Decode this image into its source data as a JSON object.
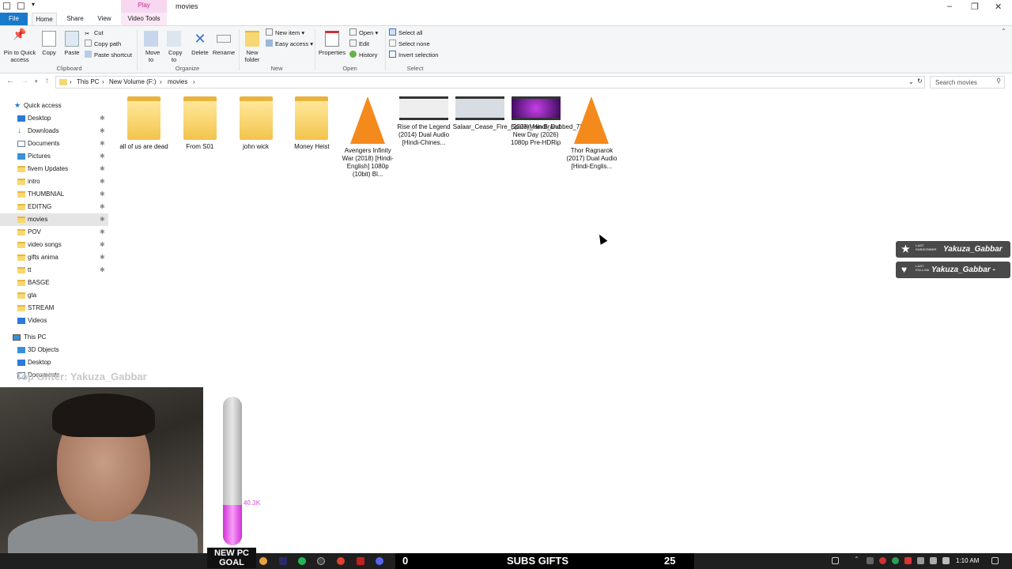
{
  "window": {
    "title": "movies",
    "context_tab": "Play",
    "tabs": [
      "File",
      "Home",
      "Share",
      "View",
      "Video Tools"
    ]
  },
  "ribbon": {
    "clipboard": {
      "pin": "Pin to Quick access",
      "copy": "Copy",
      "paste": "Paste",
      "cut": "Cut",
      "copy_path": "Copy path",
      "paste_shortcut": "Paste shortcut",
      "label": "Clipboard"
    },
    "organize": {
      "move_to": "Move to",
      "copy_to": "Copy to",
      "delete": "Delete",
      "rename": "Rename",
      "label": "Organize"
    },
    "new": {
      "new_folder": "New folder",
      "new_item": "New item",
      "easy_access": "Easy access",
      "label": "New"
    },
    "open": {
      "properties": "Properties",
      "open": "Open",
      "edit": "Edit",
      "history": "History",
      "label": "Open"
    },
    "select": {
      "select_all": "Select all",
      "select_none": "Select none",
      "invert": "Invert selection",
      "label": "Select"
    }
  },
  "address": {
    "crumbs": [
      "This PC",
      "New Volume (F:)",
      "movies"
    ],
    "search_placeholder": "Search movies"
  },
  "nav": {
    "quick_access": "Quick access",
    "items": [
      {
        "label": "Desktop",
        "icon": "desktop-icon",
        "pinned": true
      },
      {
        "label": "Downloads",
        "icon": "download-icon",
        "pinned": true
      },
      {
        "label": "Documents",
        "icon": "document-icon",
        "pinned": true
      },
      {
        "label": "Pictures",
        "icon": "picture-icon",
        "pinned": true
      },
      {
        "label": "fivem Updates",
        "icon": "folder-icon",
        "pinned": true
      },
      {
        "label": "intro",
        "icon": "folder-icon",
        "pinned": true
      },
      {
        "label": "THUMBNIAL",
        "icon": "folder-icon",
        "pinned": true
      },
      {
        "label": "EDITNG",
        "icon": "folder-icon",
        "pinned": true
      },
      {
        "label": "movies",
        "icon": "folder-icon",
        "pinned": true,
        "selected": true
      },
      {
        "label": "POV",
        "icon": "folder-icon",
        "pinned": true
      },
      {
        "label": "video songs",
        "icon": "folder-icon",
        "pinned": true
      },
      {
        "label": "gifts anima",
        "icon": "folder-icon",
        "pinned": true
      },
      {
        "label": "tt",
        "icon": "folder-icon",
        "pinned": true
      },
      {
        "label": "BASGE",
        "icon": "folder-icon",
        "pinned": false
      },
      {
        "label": "gta",
        "icon": "folder-icon",
        "pinned": false
      },
      {
        "label": "STREAM",
        "icon": "folder-icon",
        "pinned": false
      },
      {
        "label": "Videos",
        "icon": "video-icon",
        "pinned": false
      }
    ],
    "this_pc": "This PC",
    "pc_items": [
      {
        "label": "3D Objects",
        "icon": "cube-icon"
      },
      {
        "label": "Desktop",
        "icon": "desktop-icon"
      },
      {
        "label": "Documents",
        "icon": "document-icon"
      }
    ]
  },
  "files": [
    {
      "name": "all of us are dead",
      "type": "folder"
    },
    {
      "name": "From S01",
      "type": "folder"
    },
    {
      "name": "john wick",
      "type": "folder"
    },
    {
      "name": "Money Heist",
      "type": "folder"
    },
    {
      "name": "Avengers Infinity War (2018) [Hindi-English] 1080p (10bit) Bl...",
      "type": "vlc"
    },
    {
      "name": "Rise of the Legend (2014) Dual Audio [Hindi-Chines...",
      "type": "video"
    },
    {
      "name": "Salaar_Cease_Fire_(2023)_Hindi_Dubbed_720pcc",
      "type": "video"
    },
    {
      "name": "SpiderMan-Brand New Day (2026) 1080p Pre-HDRip",
      "type": "video-purple"
    },
    {
      "name": "Thor Ragnarok (2017) Dual Audio [Hindi-Englis...",
      "type": "vlc"
    }
  ],
  "overlay": {
    "last_sub_small": "LAST SUBSCRIBER",
    "last_sub": "Yakuza_Gabbar",
    "last_follow_small": "LAST FOLLOW",
    "last_follow": "Yakuza_Gabbar -",
    "gifter": "Top Gifter: Yakuza_Gabbar",
    "goal_value": "40.3K",
    "goal_fraction": 0.27,
    "goal_label": "NEW PC GOAL",
    "subs_count": "0",
    "subs_label": "SUBS GIFTS",
    "subs_right": "25"
  },
  "taskbar": {
    "clock": "1:10 AM"
  }
}
